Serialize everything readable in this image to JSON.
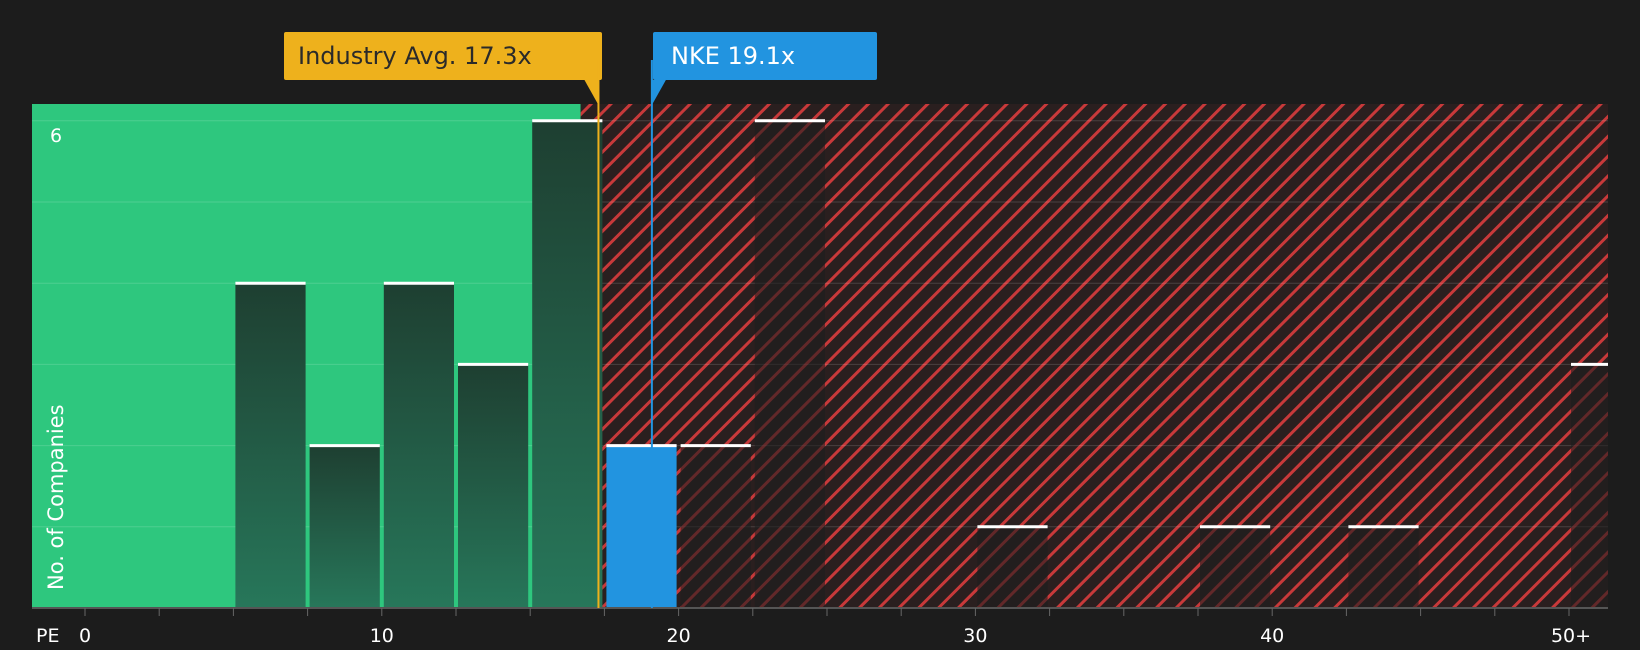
{
  "chart_data": {
    "type": "bar",
    "xlabel": "PE",
    "ylabel": "No. of Companies",
    "xlim": [
      0,
      51.8
    ],
    "ylim": [
      0,
      6.2
    ],
    "x_ticks": [
      {
        "value": 0,
        "label": "0"
      },
      {
        "value": 10,
        "label": "10"
      },
      {
        "value": 20,
        "label": "20"
      },
      {
        "value": 30,
        "label": "30"
      },
      {
        "value": 40,
        "label": "40"
      },
      {
        "value": 50,
        "label": "50+"
      }
    ],
    "y_tick_labels": [
      {
        "value": 6,
        "label": "6"
      }
    ],
    "bins": [
      {
        "start": 5,
        "end": 7.5,
        "count": 4
      },
      {
        "start": 7.5,
        "end": 10,
        "count": 2
      },
      {
        "start": 10,
        "end": 12.5,
        "count": 4
      },
      {
        "start": 12.5,
        "end": 15,
        "count": 3
      },
      {
        "start": 15,
        "end": 17.5,
        "count": 6
      },
      {
        "start": 17.5,
        "end": 20,
        "count": 2,
        "highlight": true
      },
      {
        "start": 20,
        "end": 22.5,
        "count": 2
      },
      {
        "start": 22.5,
        "end": 25,
        "count": 6
      },
      {
        "start": 30,
        "end": 32.5,
        "count": 1
      },
      {
        "start": 37.5,
        "end": 40,
        "count": 1
      },
      {
        "start": 42.5,
        "end": 45,
        "count": 1
      },
      {
        "start": 50,
        "end": 52.5,
        "count": 3
      }
    ],
    "industry_avg": {
      "value": 17.3,
      "label": "Industry Avg. 17.3x"
    },
    "company": {
      "value": 19.1,
      "label": "NKE 19.1x"
    },
    "fair_region_end": 16.7,
    "colors": {
      "background": "#1c1c1c",
      "green_zone": "#2ec77e",
      "red_hatch": "#c8393a",
      "highlight_bar": "#2294e0",
      "industry": "#eeb11c",
      "company": "#2294e0"
    },
    "grid": true
  }
}
